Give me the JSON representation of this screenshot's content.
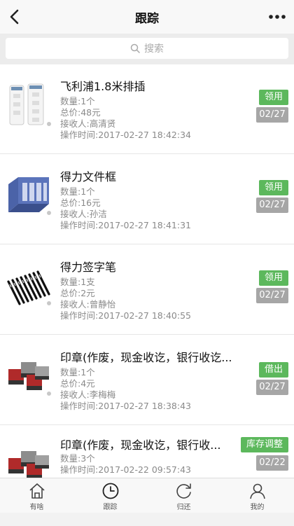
{
  "nav": {
    "title": "跟踪"
  },
  "search": {
    "placeholder": "搜索"
  },
  "items": [
    {
      "title": "飞利浦1.8米排插",
      "qty": "数量:1个",
      "price": "总价:48元",
      "receiver": "接收人:高清贤",
      "time": "操作时间:2017-02-27 18:42:34",
      "type": "领用",
      "date": "02/27",
      "type_color": "#5cb85c",
      "icon": "power-strip-icon"
    },
    {
      "title": "得力文件框",
      "qty": "数量:1个",
      "price": "总价:16元",
      "receiver": "接收人:孙洁",
      "time": "操作时间:2017-02-27 18:41:31",
      "type": "领用",
      "date": "02/27",
      "type_color": "#5cb85c",
      "icon": "file-rack-icon"
    },
    {
      "title": "得力签字笔",
      "qty": "数量:1支",
      "price": "总价:2元",
      "receiver": "接收人:曾静怡",
      "time": "操作时间:2017-02-27 18:40:55",
      "type": "领用",
      "date": "02/27",
      "type_color": "#5cb85c",
      "icon": "pens-icon"
    },
    {
      "title": "印章(作废，现金收讫，银行收讫...",
      "qty": "数量:1个",
      "price": "总价:4元",
      "receiver": "接收人:李梅梅",
      "time": "操作时间:2017-02-27 18:38:43",
      "type": "借出",
      "date": "02/27",
      "type_color": "#5cb85c",
      "icon": "stamps-icon"
    },
    {
      "title": "印章(作废，现金收讫，银行收...",
      "qty": "数量:3个",
      "price": "",
      "receiver": "",
      "time": "操作时间:2017-02-22 09:57:43",
      "type": "库存调整",
      "date": "02/22",
      "type_color": "#5cb85c",
      "icon": "stamps-icon"
    }
  ],
  "tabs": [
    {
      "label": "有啥",
      "icon": "home-icon"
    },
    {
      "label": "跟踪",
      "icon": "clock-icon"
    },
    {
      "label": "归还",
      "icon": "return-icon"
    },
    {
      "label": "我的",
      "icon": "user-icon"
    }
  ]
}
